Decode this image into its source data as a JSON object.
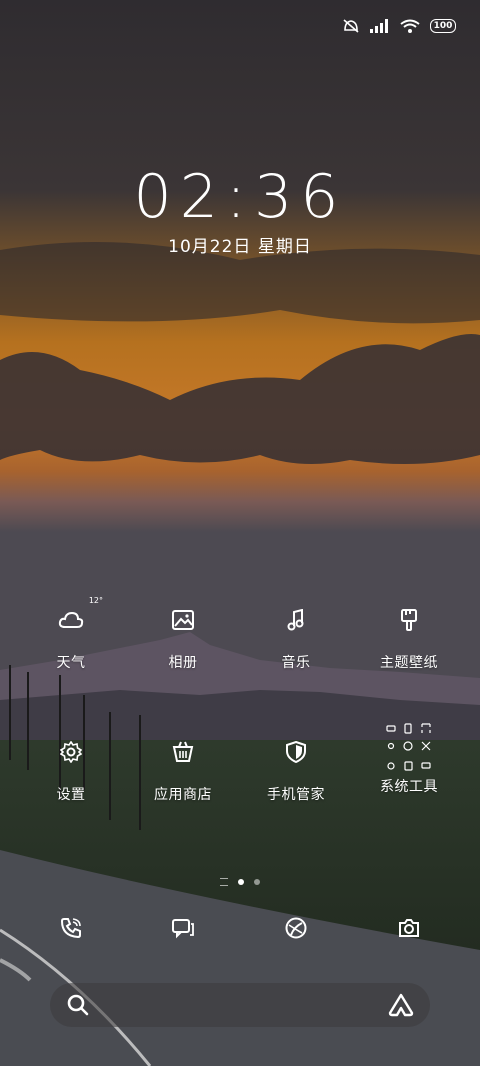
{
  "status_bar": {
    "battery": "100",
    "icons": [
      "mute-icon",
      "cell-signal-icon",
      "wifi-icon",
      "battery-icon"
    ]
  },
  "lock": {
    "time": "02:36",
    "date": "10月22日 星期日"
  },
  "apps_row1": [
    {
      "label": "天气",
      "icon": "cloud-icon",
      "badge": "12°"
    },
    {
      "label": "相册",
      "icon": "gallery-icon"
    },
    {
      "label": "音乐",
      "icon": "music-note-icon"
    },
    {
      "label": "主题壁纸",
      "icon": "theme-brush-icon"
    }
  ],
  "apps_row2": [
    {
      "label": "设置",
      "icon": "gear-icon"
    },
    {
      "label": "应用商店",
      "icon": "store-basket-icon"
    },
    {
      "label": "手机管家",
      "icon": "shield-icon"
    },
    {
      "label": "系统工具",
      "icon": "tools-folder-icon"
    }
  ],
  "dock": [
    {
      "icon": "phone-icon"
    },
    {
      "icon": "messages-icon"
    },
    {
      "icon": "browser-icon"
    },
    {
      "icon": "camera-icon"
    }
  ],
  "pager": {
    "current_page": 1,
    "page_count": 2
  },
  "colors": {
    "sky_top": "#3a3538",
    "sunset": "#d98b2a",
    "ground": "#3c4a36"
  }
}
